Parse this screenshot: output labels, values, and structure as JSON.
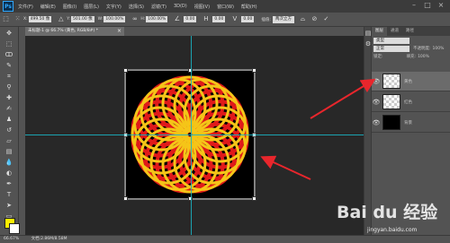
{
  "app": {
    "logo": "Ps"
  },
  "menubar": {
    "items": [
      "文件(F)",
      "编辑(E)",
      "图像(I)",
      "图层(L)",
      "文字(Y)",
      "选择(S)",
      "滤镜(T)",
      "3D(D)",
      "视图(V)",
      "窗口(W)",
      "帮助(H)"
    ]
  },
  "options": {
    "x_label": "X:",
    "x_value": "499.50 像",
    "y_label": "Y:",
    "y_value": "501.00 像",
    "w_label": "W:",
    "w_value": "100.00%",
    "h_label": "H:",
    "h_value": "100.00%",
    "angle_value": "0.00",
    "h2_value": "0.00",
    "v_value": "0.00",
    "interp_label": "插值:",
    "interp_value": "两次立方"
  },
  "document": {
    "tab_label": "未标题-1 @ 66.7% (黄色, RGB/8#) *",
    "close_glyph": "×"
  },
  "status": {
    "zoom": "66.67%",
    "doc_info": "文档:2.86M/8.58M"
  },
  "layers_panel": {
    "tabs": [
      "图层",
      "通道",
      "路径"
    ],
    "kind_label": "类型",
    "blend_mode": "正常",
    "opacity_label": "不透明度:",
    "opacity_value": "100%",
    "lock_label": "锁定:",
    "fill_label": "填充:",
    "fill_value": "100%",
    "layers": [
      {
        "name": "黄色",
        "selected": true
      },
      {
        "name": "红色",
        "selected": false
      },
      {
        "name": "背景",
        "selected": false
      }
    ]
  },
  "colors": {
    "foreground": "#ffee00",
    "background": "#ffffff",
    "guide": "#19b0c0",
    "arrow": "#e8262c"
  },
  "watermark": {
    "brand": "Bai du 经验",
    "url": "jingyan.baidu.com"
  }
}
